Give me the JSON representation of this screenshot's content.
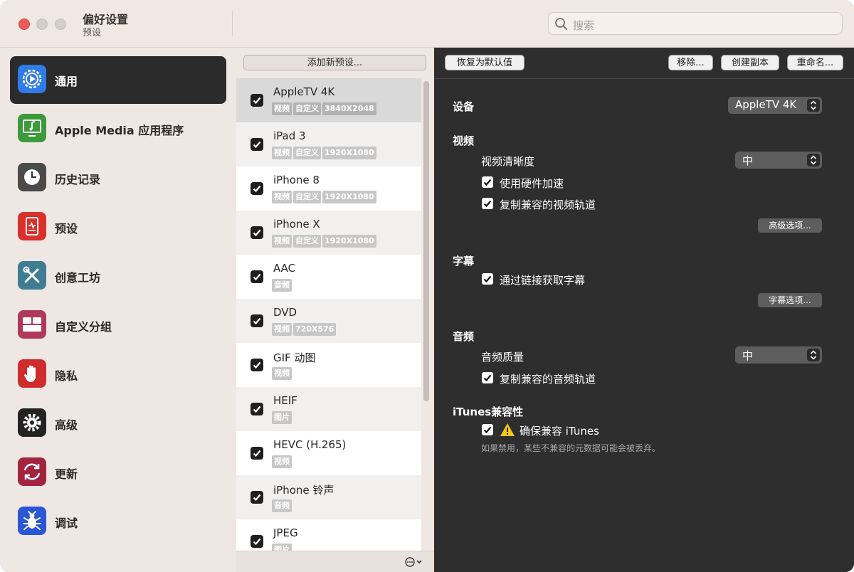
{
  "window": {
    "title": "偏好设置",
    "subtitle": "预设",
    "search_placeholder": "搜索"
  },
  "sidebar": {
    "items": [
      {
        "label": "通用",
        "icon": "gear-badge-icon",
        "color": "#2f7be8",
        "active": true
      },
      {
        "label": "Apple Media 应用程序",
        "icon": "monitor-music-icon",
        "color": "#3d9a3c"
      },
      {
        "label": "历史记录",
        "icon": "clock-icon",
        "color": "#4a4a4a"
      },
      {
        "label": "预设",
        "icon": "document-icon",
        "color": "#d9302b"
      },
      {
        "label": "创意工坊",
        "icon": "tools-icon",
        "color": "#3f7d93"
      },
      {
        "label": "自定义分组",
        "icon": "grid-icon",
        "color": "#b13a5c"
      },
      {
        "label": "隐私",
        "icon": "hand-icon",
        "color": "#cf2c2c"
      },
      {
        "label": "高级",
        "icon": "gear-icon",
        "color": "#232323"
      },
      {
        "label": "更新",
        "icon": "refresh-icon",
        "color": "#a2243f"
      },
      {
        "label": "调试",
        "icon": "bug-icon",
        "color": "#2b57d6"
      }
    ]
  },
  "presets": {
    "add_button": "添加新预设...",
    "items": [
      {
        "title": "AppleTV 4K",
        "tags": [
          "视频",
          "自定义",
          "3840X2048"
        ],
        "checked": true,
        "selected": true
      },
      {
        "title": "iPad 3",
        "tags": [
          "视频",
          "自定义",
          "1920X1080"
        ],
        "checked": true
      },
      {
        "title": "iPhone 8",
        "tags": [
          "视频",
          "自定义",
          "1920X1080"
        ],
        "checked": true
      },
      {
        "title": "iPhone X",
        "tags": [
          "视频",
          "自定义",
          "1920X1080"
        ],
        "checked": true
      },
      {
        "title": "AAC",
        "tags": [
          "音频"
        ],
        "checked": true
      },
      {
        "title": "DVD",
        "tags": [
          "视频",
          "720X576"
        ],
        "checked": true
      },
      {
        "title": "GIF 动图",
        "tags": [
          "视频"
        ],
        "checked": true
      },
      {
        "title": "HEIF",
        "tags": [
          "图片"
        ],
        "checked": true
      },
      {
        "title": "HEVC (H.265)",
        "tags": [
          "视频"
        ],
        "checked": true
      },
      {
        "title": "iPhone 铃声",
        "tags": [
          "音频"
        ],
        "checked": true
      },
      {
        "title": "JPEG",
        "tags": [
          "图片"
        ],
        "checked": true
      }
    ]
  },
  "detail": {
    "toolbar": {
      "reset": "恢复为默认值",
      "remove": "移除...",
      "duplicate": "创建副本",
      "rename": "重命名..."
    },
    "device_label": "设备",
    "device_value": "AppleTV 4K",
    "video": {
      "heading": "视频",
      "quality_label": "视频清晰度",
      "quality_value": "中",
      "hw_accel": "使用硬件加速",
      "copy_compatible_video": "复制兼容的视频轨道",
      "advanced_button": "高级选项..."
    },
    "subtitles": {
      "heading": "字幕",
      "fetch_via_link": "通过链接获取字幕",
      "options_button": "字幕选项..."
    },
    "audio": {
      "heading": "音频",
      "quality_label": "音频质量",
      "quality_value": "中",
      "copy_compatible_audio": "复制兼容的音频轨道"
    },
    "itunes": {
      "heading": "iTunes兼容性",
      "ensure_compatible": "确保兼容 iTunes",
      "note": "如果禁用，某些不兼容的元数据可能会被丢弃。"
    }
  }
}
